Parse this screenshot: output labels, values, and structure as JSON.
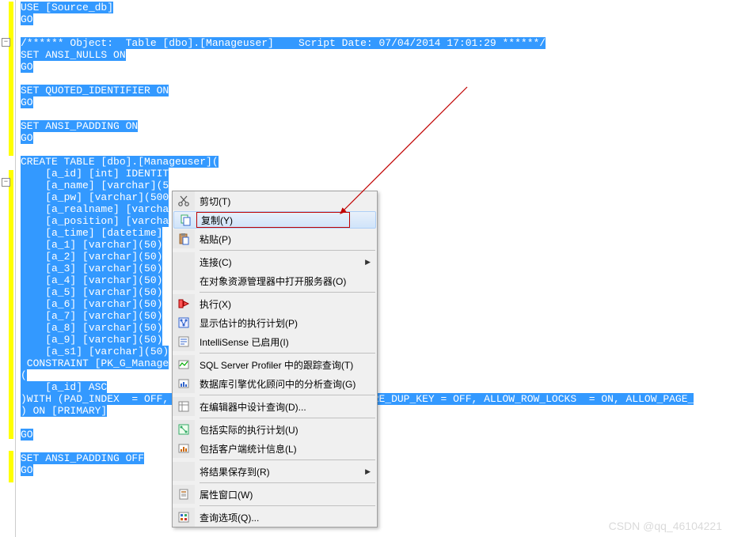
{
  "code_lines": [
    {
      "text": "USE [Source_db]",
      "hl": true
    },
    {
      "text": "GO",
      "hl": true
    },
    {
      "text": "",
      "hl": false
    },
    {
      "text": "/****** Object:  Table [dbo].[Manageuser]    Script Date: 07/04/2014 17:01:29 ******/",
      "hl": true
    },
    {
      "text": "SET ANSI_NULLS ON",
      "hl": true
    },
    {
      "text": "GO",
      "hl": true
    },
    {
      "text": "",
      "hl": false
    },
    {
      "text": "SET QUOTED_IDENTIFIER ON",
      "hl": true
    },
    {
      "text": "GO",
      "hl": true
    },
    {
      "text": "",
      "hl": false
    },
    {
      "text": "SET ANSI_PADDING ON",
      "hl": true
    },
    {
      "text": "GO",
      "hl": true
    },
    {
      "text": "",
      "hl": false
    },
    {
      "text": "CREATE TABLE [dbo].[Manageuser](",
      "hl": true
    },
    {
      "text": "    [a_id] [int] IDENTIT",
      "hl": true,
      "indent": true
    },
    {
      "text": "    [a_name] [varchar](5",
      "hl": true,
      "indent": true
    },
    {
      "text": "    [a_pw] [varchar](500",
      "hl": true,
      "indent": true
    },
    {
      "text": "    [a_realname] [varcha",
      "hl": true,
      "indent": true
    },
    {
      "text": "    [a_position] [varcha",
      "hl": true,
      "indent": true
    },
    {
      "text": "    [a_time] [datetime]",
      "hl": true,
      "indent": true
    },
    {
      "text": "    [a_1] [varchar](50)",
      "hl": true,
      "indent": true
    },
    {
      "text": "    [a_2] [varchar](50)",
      "hl": true,
      "indent": true
    },
    {
      "text": "    [a_3] [varchar](50)",
      "hl": true,
      "indent": true
    },
    {
      "text": "    [a_4] [varchar](50)",
      "hl": true,
      "indent": true
    },
    {
      "text": "    [a_5] [varchar](50)",
      "hl": true,
      "indent": true
    },
    {
      "text": "    [a_6] [varchar](50)",
      "hl": true,
      "indent": true
    },
    {
      "text": "    [a_7] [varchar](50)",
      "hl": true,
      "indent": true
    },
    {
      "text": "    [a_8] [varchar](50)",
      "hl": true,
      "indent": true
    },
    {
      "text": "    [a_9] [varchar](50)",
      "hl": true,
      "indent": true
    },
    {
      "text": "    [a_s1] [varchar](50)",
      "hl": true,
      "indent": true
    },
    {
      "text": " CONSTRAINT [PK_G_Manage",
      "hl": true
    },
    {
      "text": "(",
      "hl": true
    },
    {
      "text": "    [a_id] ASC",
      "hl": true,
      "indent": true
    },
    {
      "text": ")WITH (PAD_INDEX  = OFF,                              GNORE_DUP_KEY = OFF, ALLOW_ROW_LOCKS  = ON, ALLOW_PAGE_",
      "hl": true
    },
    {
      "text": ") ON [PRIMARY]",
      "hl": true
    },
    {
      "text": "",
      "hl": false
    },
    {
      "text": "GO",
      "hl": true
    },
    {
      "text": "",
      "hl": false
    },
    {
      "text": "SET ANSI_PADDING OFF",
      "hl": true
    },
    {
      "text": "GO",
      "hl": true
    }
  ],
  "context_menu": {
    "items": [
      {
        "label": "剪切(T)",
        "icon": "cut",
        "submenu": false
      },
      {
        "label": "复制(Y)",
        "icon": "copy",
        "submenu": false,
        "highlighted": true
      },
      {
        "label": "粘贴(P)",
        "icon": "paste",
        "submenu": false
      },
      {
        "sep": true
      },
      {
        "label": "连接(C)",
        "icon": "",
        "submenu": true
      },
      {
        "label": "在对象资源管理器中打开服务器(O)",
        "icon": "",
        "submenu": false
      },
      {
        "sep": true
      },
      {
        "label": "执行(X)",
        "icon": "execute",
        "submenu": false
      },
      {
        "label": "显示估计的执行计划(P)",
        "icon": "plan",
        "submenu": false
      },
      {
        "label": "IntelliSense 已启用(I)",
        "icon": "intellisense",
        "submenu": false
      },
      {
        "sep": true
      },
      {
        "label": "SQL Server Profiler 中的跟踪查询(T)",
        "icon": "profiler",
        "submenu": false
      },
      {
        "label": "数据库引擎优化顾问中的分析查询(G)",
        "icon": "advisor",
        "submenu": false
      },
      {
        "sep": true
      },
      {
        "label": "在编辑器中设计查询(D)...",
        "icon": "design",
        "submenu": false
      },
      {
        "sep": true
      },
      {
        "label": "包括实际的执行计划(U)",
        "icon": "actualplan",
        "submenu": false
      },
      {
        "label": "包括客户端统计信息(L)",
        "icon": "stats",
        "submenu": false
      },
      {
        "sep": true
      },
      {
        "label": "将结果保存到(R)",
        "icon": "",
        "submenu": true
      },
      {
        "sep": true
      },
      {
        "label": "属性窗口(W)",
        "icon": "properties",
        "submenu": false
      },
      {
        "sep": true
      },
      {
        "label": "查询选项(Q)...",
        "icon": "options",
        "submenu": false
      }
    ]
  },
  "watermark": "CSDN @qq_46104221"
}
